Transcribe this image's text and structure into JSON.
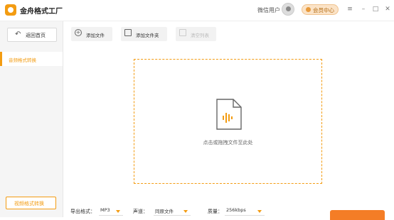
{
  "app": {
    "title": "金舟格式工厂"
  },
  "header": {
    "user_label": "微信用户",
    "vip_label": "会员中心"
  },
  "sidebar": {
    "back_label": "返回首页",
    "items": [
      {
        "label": "音频格式转换",
        "active": true
      }
    ],
    "footer_label": "视频格式转换"
  },
  "toolbar": {
    "add_file_label": "添加文件",
    "add_folder_label": "添加文件夹",
    "clear_label": "清空列表"
  },
  "dropzone": {
    "hint": "点击或拖拽文件至此处"
  },
  "options": {
    "format_label": "导出格式：",
    "format_value": "MP3",
    "channel_label": "声道：",
    "channel_value": "同原文件",
    "quality_label": "质量：",
    "quality_value": "256kbps"
  },
  "colors": {
    "accent": "#f39c12",
    "start": "#f47d26"
  }
}
